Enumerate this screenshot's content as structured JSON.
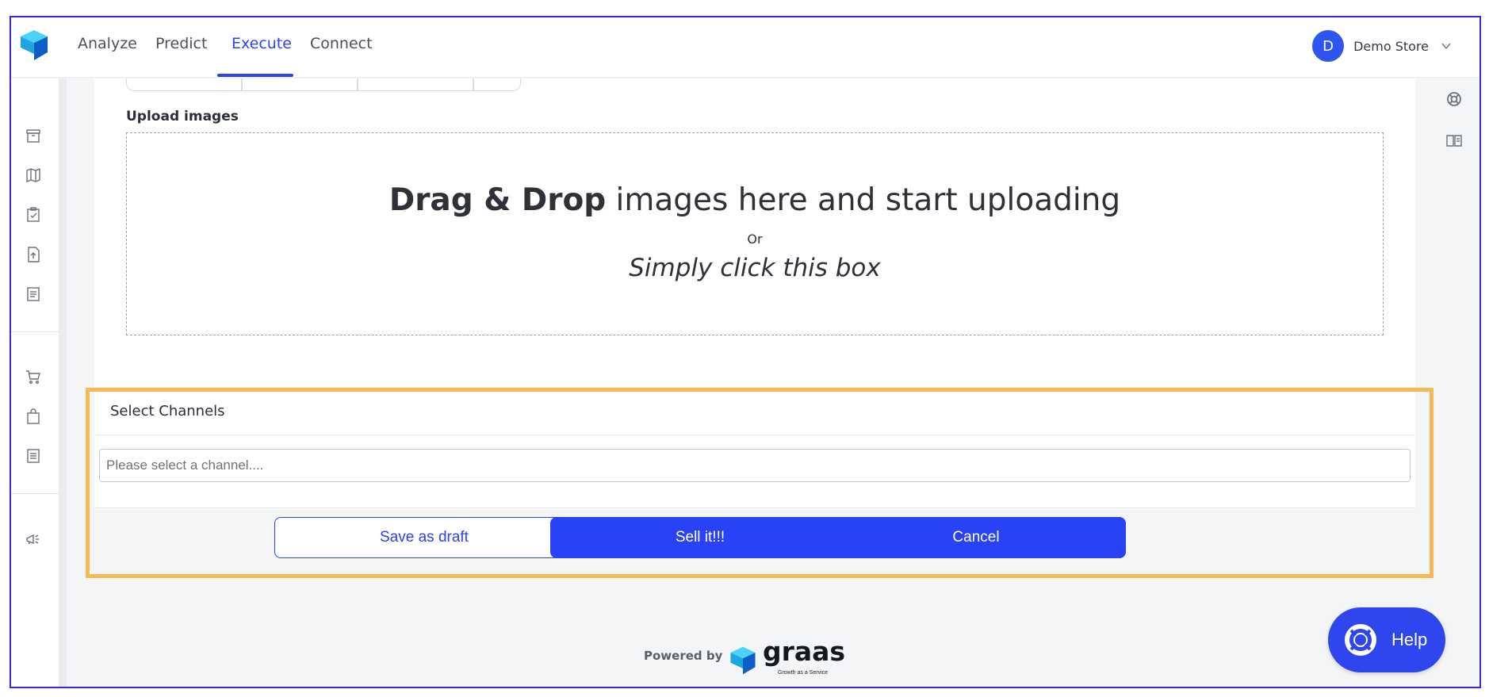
{
  "nav": {
    "items": [
      {
        "label": "Analyze",
        "active": false
      },
      {
        "label": "Predict",
        "active": false
      },
      {
        "label": "Execute",
        "active": true
      },
      {
        "label": "Connect",
        "active": false
      }
    ]
  },
  "user": {
    "initial": "D",
    "name": "Demo Store"
  },
  "sidebar": {
    "icons": [
      "archive-icon",
      "map-icon",
      "clipboard-check-icon",
      "file-upload-icon",
      "document-list-icon",
      "cart-icon",
      "shopping-bag-icon",
      "document-lines-icon",
      "megaphone-icon"
    ]
  },
  "rail": {
    "icons": [
      "lifebuoy-icon",
      "book-icon"
    ]
  },
  "upload": {
    "label": "Upload images",
    "title_bold": "Drag & Drop",
    "title_rest": " images here and start uploading",
    "or": "Or",
    "click_text": "Simply click this box"
  },
  "channels": {
    "title": "Select Channels",
    "placeholder": "Please select a channel...."
  },
  "actions": {
    "save_draft": "Save as draft",
    "sell": "Sell it!!!",
    "cancel": "Cancel"
  },
  "footer": {
    "powered_by": "Powered by",
    "brand": "graas",
    "tagline": "Growth as a Service"
  },
  "help": {
    "label": "Help"
  },
  "colors": {
    "accent": "#2a42f0",
    "highlight": "#f7b955",
    "brand_cyan": "#1fb6e8",
    "frame_border": "#3a2bd9"
  }
}
